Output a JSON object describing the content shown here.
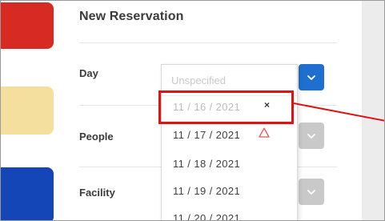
{
  "form": {
    "title": "New Reservation",
    "rows": [
      {
        "label": "Day"
      },
      {
        "label": "People"
      },
      {
        "label": "Facility"
      }
    ]
  },
  "dropdown": {
    "placeholder": "Unspecified",
    "options": [
      {
        "label": "11 / 16 / 2021",
        "state": "disabled"
      },
      {
        "label": "11 / 17 / 2021",
        "state": "warning"
      },
      {
        "label": "11 / 18 / 2021"
      },
      {
        "label": "11 / 19 / 2021"
      },
      {
        "label": "11 / 20 / 2021"
      }
    ]
  },
  "markers": {
    "close_glyph": "×",
    "warning_icon": "warning-triangle-icon"
  },
  "colors": {
    "accent_red": "#d62a22",
    "accent_yellow": "#f5df9e",
    "accent_blue": "#1446b8",
    "select_active": "#1f6fd1",
    "select_inactive": "#c9c9c9",
    "highlight": "#e01313"
  }
}
